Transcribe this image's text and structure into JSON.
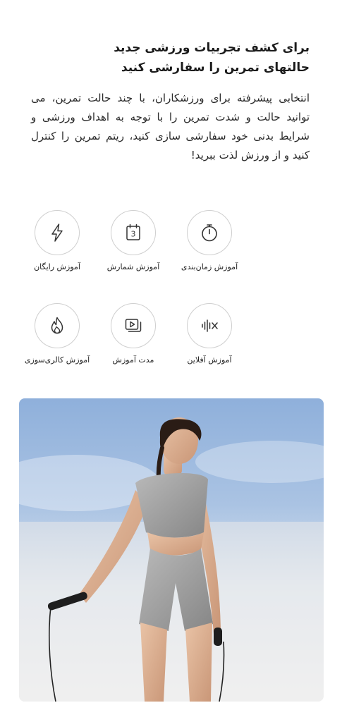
{
  "headline": {
    "line1": "برای کشف تجربیات ورزشی جدید",
    "line2": "حالتهای تمرین را سفارشی کنید"
  },
  "description": "انتخابی پیشرفته برای ورزشکاران، با چند حالت تمرین، می توانید حالت و شدت تمرین را با توجه به اهداف ورزشی و شرایط بدنی خود سفارشی سازی کنید، ریتم تمرین را کنترل کنید و از ورزش لذت ببرید!",
  "features": [
    {
      "label": "آموزش زمان‌بندی",
      "icon": "stopwatch-icon"
    },
    {
      "label": "آموزش شمارش",
      "icon": "calendar-count-icon",
      "glyph": "3"
    },
    {
      "label": "آموزش رایگان",
      "icon": "lightning-icon"
    },
    {
      "label": "آموزش آفلاین",
      "icon": "offline-wave-icon"
    },
    {
      "label": "مدت آموزش",
      "icon": "video-duration-icon"
    },
    {
      "label": "آموزش کالری‌سوزی",
      "icon": "flame-icon"
    }
  ],
  "hero": {
    "subject": "woman-jump-rope-photo"
  },
  "colors": {
    "text": "#222222",
    "icon_stroke": "#333333",
    "circle_border": "#cfcfcf",
    "sky_top": "#8fb0db",
    "sky_bottom": "#ececec"
  }
}
